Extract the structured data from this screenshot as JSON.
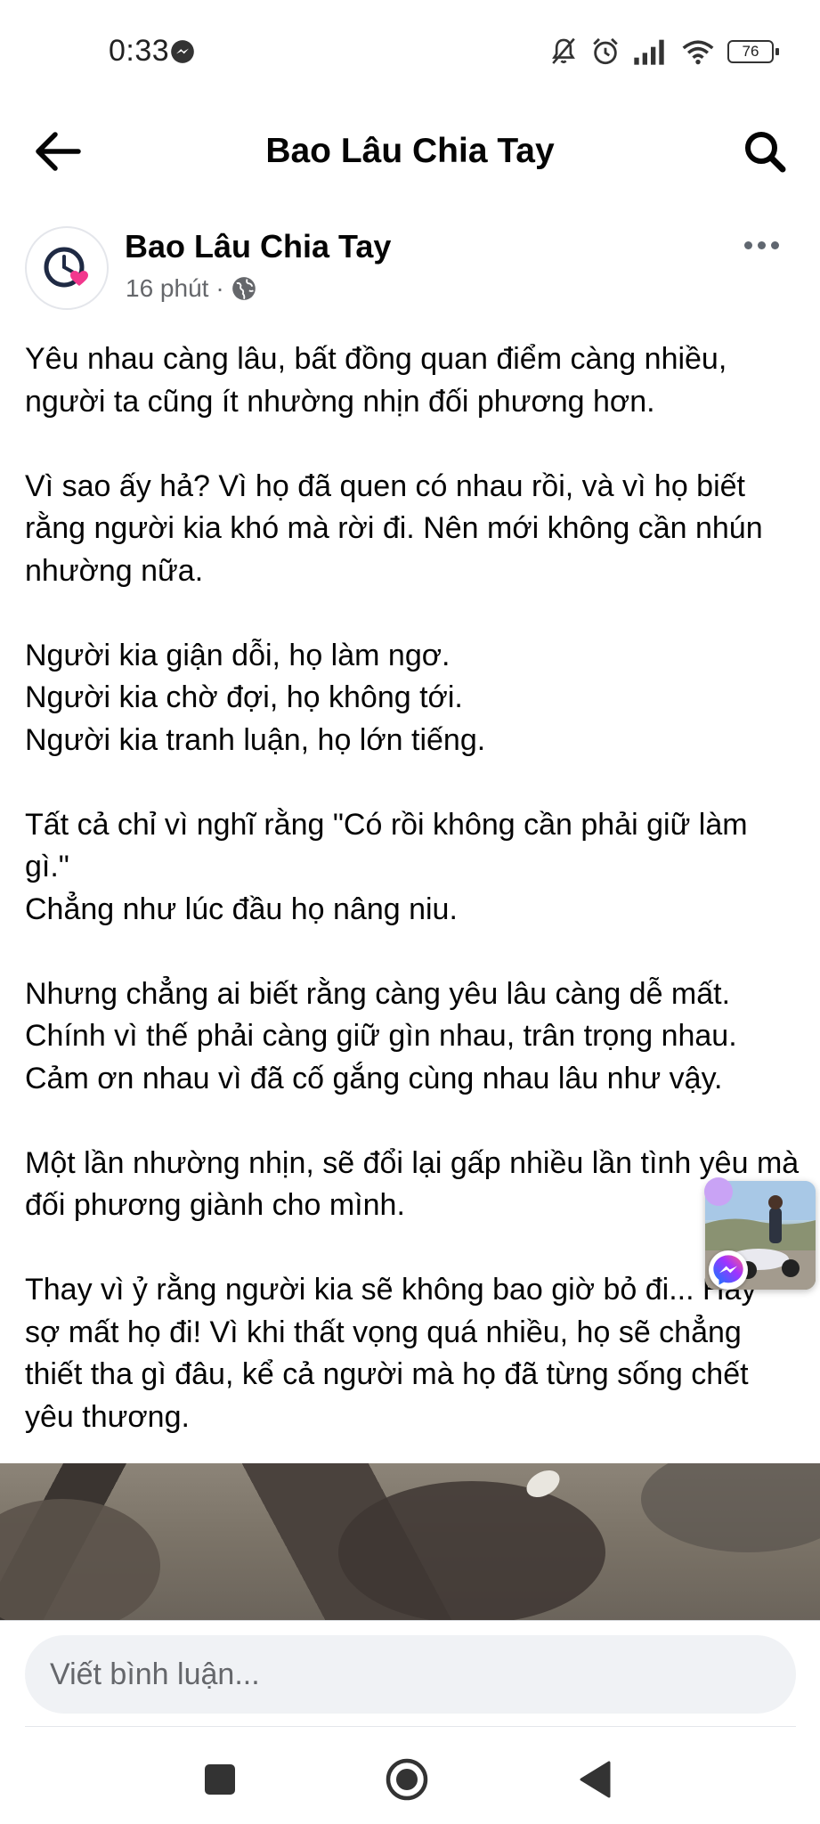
{
  "status_bar": {
    "time": "0:33",
    "battery": "76",
    "icons": [
      "messenger-icon",
      "bell-mute-icon",
      "alarm-icon",
      "signal-icon",
      "wifi-icon",
      "battery-icon"
    ]
  },
  "header": {
    "title": "Bao Lâu Chia Tay",
    "back_icon": "arrow-left-icon",
    "search_icon": "search-icon"
  },
  "post": {
    "author": "Bao Lâu Chia Tay",
    "time": "16 phút",
    "separator": "·",
    "privacy_icon": "globe-icon",
    "more_icon": "more-horizontal-icon",
    "paragraphs": [
      "Yêu nhau càng lâu, bất đồng quan điểm càng nhiều, người ta cũng ít nhường nhịn đối phương hơn.",
      "Vì sao ấy hả? Vì họ đã quen có nhau rồi, và vì họ biết rằng người kia khó mà rời đi. Nên mới không cần nhún nhường nữa.",
      "Người kia giận dỗi, họ làm ngơ.\nNgười kia chờ đợi, họ không tới.\nNgười kia tranh luận, họ lớn tiếng.",
      "Tất cả chỉ vì nghĩ rằng \"Có rồi không cần phải giữ làm gì.\"\nChẳng như lúc đầu họ nâng niu.",
      "Nhưng chẳng ai biết rằng càng yêu lâu càng dễ mất. Chính vì thế phải càng giữ gìn nhau, trân trọng nhau. Cảm ơn nhau vì đã cố gắng cùng nhau lâu như vậy.",
      "Một lần nhường nhịn, sẽ đổi lại gấp nhiều lần tình yêu mà đối phương giành cho mình.",
      "Thay vì ỷ rằng người kia sẽ không bao giờ bỏ đi... Hãy sợ mất họ đi! Vì khi thất vọng quá nhiều, họ sẽ chẳng thiết tha gì đâu, kể cả người mà họ đã từng sống chết yêu thương."
    ]
  },
  "comment": {
    "placeholder": "Viết bình luận..."
  },
  "nav": {
    "icons": [
      "recents-square-icon",
      "home-circle-icon",
      "back-triangle-icon"
    ]
  },
  "colors": {
    "text": "#050505",
    "secondary": "#65676b",
    "input_bg": "#f0f2f5",
    "messenger_gradient": [
      "#0a7cff",
      "#a033ff",
      "#ff5c87"
    ]
  }
}
